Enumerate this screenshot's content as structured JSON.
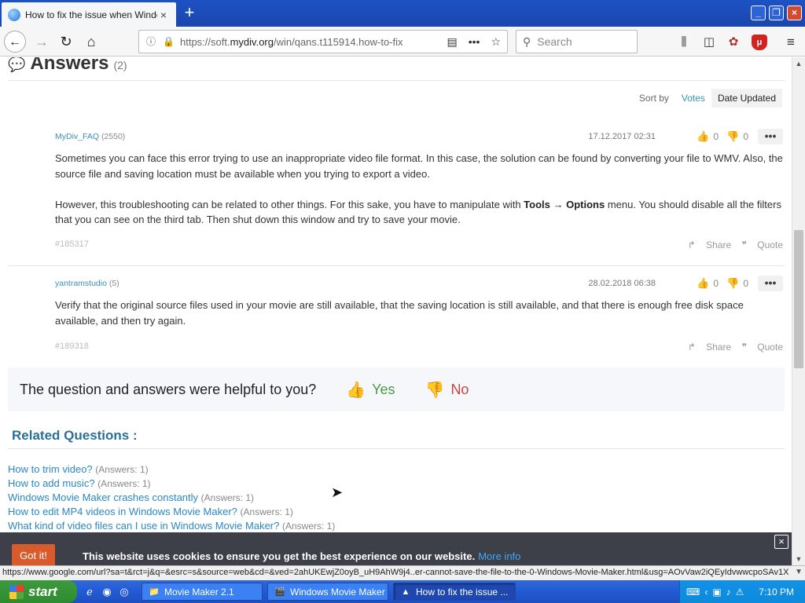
{
  "browser": {
    "tab_title": "How to fix the issue when Window",
    "tab_close": "×",
    "new_tab": "+",
    "window_buttons": {
      "minimize": "_",
      "maximize": "❐",
      "close": "×"
    },
    "url_prefix": "https://soft.",
    "url_domain": "mydiv.org",
    "url_path": "/win/qans.t115914.how-to-fix",
    "search_placeholder": "Search",
    "nav_icons": {
      "back": "←",
      "forward": "→",
      "reload": "↻",
      "home": "⌂"
    }
  },
  "answers": {
    "title": "Answers",
    "count": "(2)",
    "sort_label": "Sort by",
    "sort_options": [
      "Votes",
      "Date Updated"
    ],
    "items": [
      {
        "author": "MyDiv_FAQ",
        "rep": "(2550)",
        "date": "17.12.2017 02:31",
        "up": "0",
        "down": "0",
        "more": "•••",
        "p1": "Sometimes you can face this error trying to use an inappropriate video file format. In this case, the solution can be found by converting your file to WMV. Also, the source file and saving location must be available when you trying to export a video.",
        "p2_before": "However, this troubleshooting can be related to other things. For this sake, you have to manipulate with ",
        "p2_bold": "Tools → Options",
        "p2_after": " menu. You should disable all the filters that you can see on the third tab. Then shut down this window and try to save your movie.",
        "id": "#185317",
        "share": "Share",
        "quote": "Quote"
      },
      {
        "author": "yantramstudio",
        "rep": "(5)",
        "date": "28.02.2018 06:38",
        "up": "0",
        "down": "0",
        "more": "•••",
        "p1": "Verify that the original source files used in your movie are still available, that the saving location is still available, and that there is enough free disk space available, and then try again.",
        "id": "#189318",
        "share": "Share",
        "quote": "Quote"
      }
    ]
  },
  "helpful": {
    "question": "The question and answers were helpful to you?",
    "yes": "Yes",
    "no": "No"
  },
  "related": {
    "title": "Related Questions :",
    "items": [
      {
        "title": "How to trim video?",
        "count": "(Answers: 1)"
      },
      {
        "title": "How to add music?",
        "count": "(Answers: 1)"
      },
      {
        "title": "Windows Movie Maker crashes constantly",
        "count": "(Answers: 1)"
      },
      {
        "title": "How to edit MP4 videos in Windows Movie Maker?",
        "count": "(Answers: 1)"
      },
      {
        "title": "What kind of video files can I use in Windows Movie Maker?",
        "count": "(Answers: 1)"
      }
    ]
  },
  "cookie": {
    "button": "Got it!",
    "message": "This website uses cookies to ensure you get the best experience on our website.",
    "more": "More info",
    "close": "×"
  },
  "status_url": "https://www.google.com/url?sa=t&rct=j&q=&esrc=s&source=web&cd=&ved=2ahUKEwjZ0oyB_uH9AhW9j4..er-cannot-save-the-file-to-the-0-Windows-Movie-Maker.html&usg=AOvVaw2iQEyIdvwwcpoSAv1X6FwT",
  "taskbar": {
    "start": "start",
    "tasks": [
      "Movie Maker 2.1",
      "Windows Movie Maker",
      "How to fix the issue ..."
    ],
    "clock": "7:10 PM"
  },
  "colors": {
    "link": "#2a87c6",
    "accent_green": "#4b9b4b",
    "accent_red": "#c94545",
    "cookie_button": "#d95b2b"
  }
}
